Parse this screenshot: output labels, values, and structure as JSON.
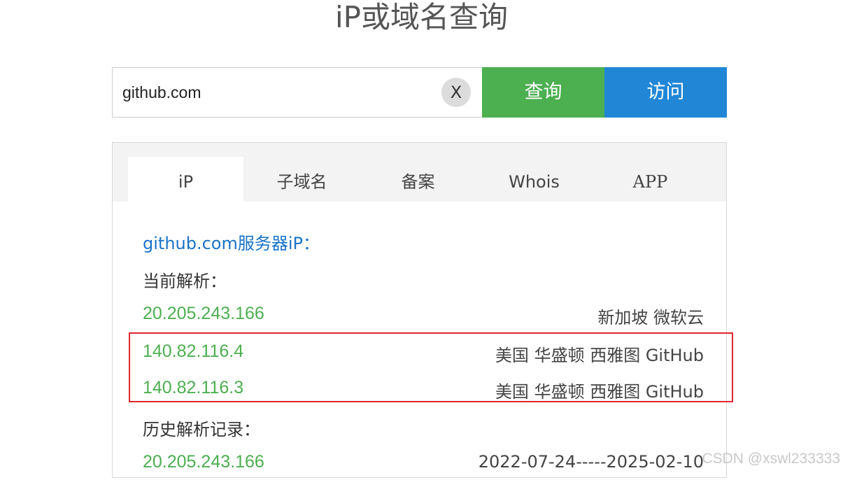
{
  "page": {
    "title": "iP或域名查询"
  },
  "search": {
    "value": "github.com",
    "clear_label": "X",
    "query_label": "查询",
    "visit_label": "访问"
  },
  "tabs": [
    {
      "label": "iP",
      "active": true
    },
    {
      "label": "子域名",
      "active": false
    },
    {
      "label": "备案",
      "active": false
    },
    {
      "label": "Whois",
      "active": false
    },
    {
      "label": "APP",
      "active": false
    }
  ],
  "result": {
    "domain": "github.com",
    "heading_suffix": "服务器iP：",
    "current_label": "当前解析：",
    "current": [
      {
        "ip": "20.205.243.166",
        "location": "新加坡 微软云"
      },
      {
        "ip": "140.82.116.4",
        "location": "美国 华盛顿 西雅图 GitHub"
      },
      {
        "ip": "140.82.116.3",
        "location": "美国 华盛顿 西雅图 GitHub"
      }
    ],
    "history_label": "历史解析记录：",
    "history": [
      {
        "ip": "20.205.243.166",
        "range": "2022-07-24-----2025-02-10"
      }
    ]
  },
  "watermark": "CSDN @xswl233333",
  "colors": {
    "query_button": "#4caf50",
    "visit_button": "#2186d6",
    "ip_text": "#4caf50",
    "heading_link": "#1a73c7",
    "highlight_box": "#e0262e"
  }
}
